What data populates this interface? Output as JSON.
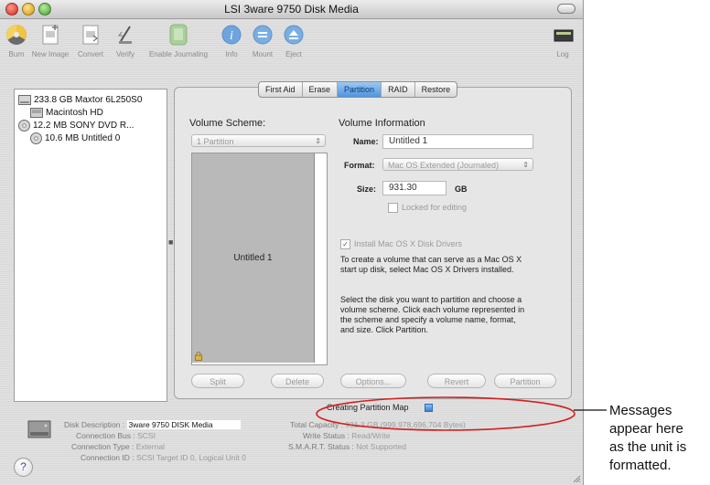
{
  "window": {
    "title": "LSI 3ware 9750 Disk Media",
    "colors": {
      "selected_tab": "#4f95dd",
      "progress": "#3b82d6",
      "annotation_ellipse": "#d42020"
    }
  },
  "toolbar": {
    "items": [
      {
        "label": "Burn",
        "icon": "burn-icon"
      },
      {
        "label": "New Image",
        "icon": "new-image-icon"
      },
      {
        "label": "Convert",
        "icon": "convert-icon"
      },
      {
        "label": "Verify",
        "icon": "verify-icon"
      },
      {
        "label": "Enable Journaling",
        "icon": "journaling-icon"
      },
      {
        "label": "Info",
        "icon": "info-icon"
      },
      {
        "label": "Mount",
        "icon": "mount-icon"
      },
      {
        "label": "Eject",
        "icon": "eject-icon"
      },
      {
        "label": "Log",
        "icon": "log-icon"
      }
    ]
  },
  "sidebar": {
    "disks": [
      {
        "label": "233.8 GB Maxtor 6L250S0",
        "icon": "hard-disk-icon"
      },
      {
        "label": "Macintosh HD",
        "icon": "volume-icon"
      },
      {
        "label": "12.2 MB SONY    DVD R...",
        "icon": "optical-disc-icon"
      },
      {
        "label": "10.6 MB Untitled 0",
        "icon": "optical-disc-icon"
      }
    ]
  },
  "tabs": [
    "First Aid",
    "Erase",
    "Partition",
    "RAID",
    "Restore"
  ],
  "selected_tab": "Partition",
  "partition": {
    "scheme_heading": "Volume Scheme:",
    "scheme_select": "1 Partition",
    "partition_label": "Untitled 1",
    "info_heading": "Volume Information",
    "name_label": "Name:",
    "name_value": "Untitled 1",
    "format_label": "Format:",
    "format_value": "Mac OS Extended (Journaled)",
    "size_label": "Size:",
    "size_value": "931.30",
    "size_unit": "GB",
    "locked_label": "Locked for editing",
    "install_drivers_label": "Install Mac OS X Disk Drivers",
    "install_drivers_checked": true,
    "drivers_help_1": "To create a volume that can serve as a Mac OS X",
    "drivers_help_2": "start up disk, select Mac OS X Drivers installed.",
    "instructions_1": "Select the disk you want to partition and choose a",
    "instructions_2": "volume scheme. Click each volume represented in",
    "instructions_3": "the scheme and specify a volume name, format,",
    "instructions_4": "and size. Click Partition.",
    "buttons": {
      "split": "Split",
      "delete": "Delete",
      "options": "Options...",
      "revert": "Revert",
      "partition": "Partition"
    }
  },
  "status": {
    "message": "Creating Partition Map",
    "progress": 0.06
  },
  "info": {
    "disk_description_label": "Disk Description :",
    "disk_description_value": "3ware 9750 DISK Media",
    "connection_bus_label": "Connection Bus :",
    "connection_bus_value": "SCSI",
    "connection_type_label": "Connection Type :",
    "connection_type_value": "External",
    "connection_id_label": "Connection ID :",
    "connection_id_value": "SCSI Target ID 0, Logical Unit 0",
    "total_capacity_label": "Total Capacity :",
    "total_capacity_value": "931.3 GB (999,978,696,704 Bytes)",
    "write_status_label": "Write Status :",
    "write_status_value": "Read/Write",
    "smart_status_label": "S.M.A.R.T. Status :",
    "smart_status_value": "Not Supported"
  },
  "annotation": {
    "line1": "Messages",
    "line2": "appear here",
    "line3": "as the unit is",
    "line4": "formatted."
  }
}
